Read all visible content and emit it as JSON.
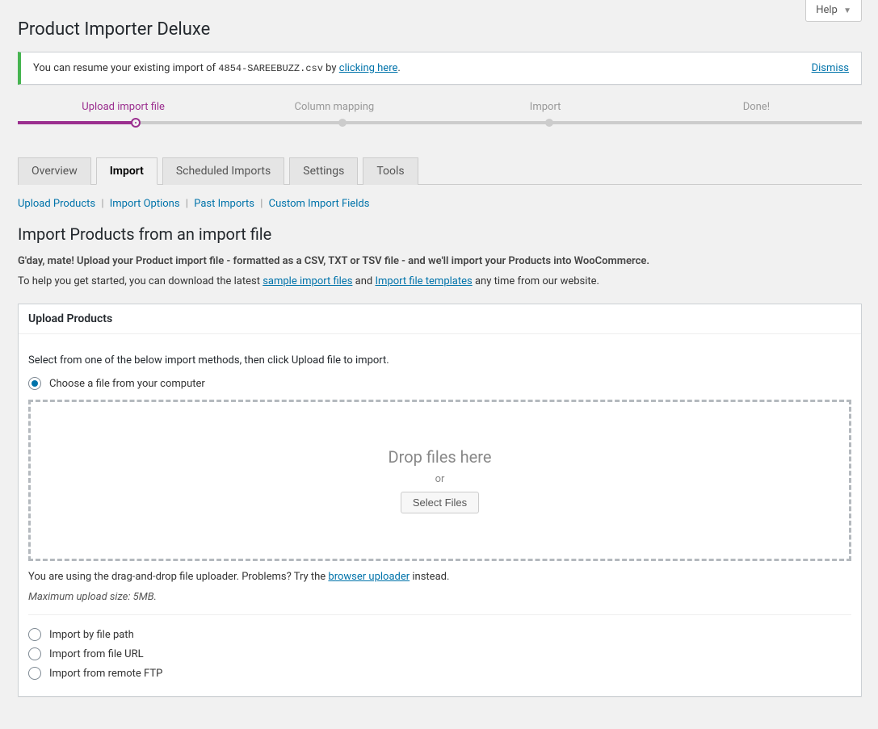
{
  "help_button": "Help",
  "page_title": "Product Importer Deluxe",
  "notice": {
    "prefix": "You can resume your existing import of ",
    "filename": "4854-SAREEBUZZ.csv",
    "by": " by ",
    "link": "clicking here",
    "suffix": ".",
    "dismiss": "Dismiss"
  },
  "steps": [
    "Upload import file",
    "Column mapping",
    "Import",
    "Done!"
  ],
  "tabs": [
    "Overview",
    "Import",
    "Scheduled Imports",
    "Settings",
    "Tools"
  ],
  "active_tab": "Import",
  "sublinks": [
    "Upload Products",
    "Import Options",
    "Past Imports",
    "Custom Import Fields"
  ],
  "section_heading": "Import Products from an import file",
  "intro_bold": "G'day, mate! Upload your Product import file - formatted as a CSV, TXT or TSV file - and we'll import your Products into WooCommerce.",
  "help_text": {
    "prefix": "To help you get started, you can download the latest ",
    "link1": "sample import files",
    "and": " and ",
    "link2": "Import file templates",
    "suffix": " any time from our website."
  },
  "postbox": {
    "title": "Upload Products",
    "select_from": "Select from one of the below import methods, then click Upload file to import.",
    "radios": [
      "Choose a file from your computer",
      "Import by file path",
      "Import from file URL",
      "Import from remote FTP"
    ],
    "dropzone": {
      "title": "Drop files here",
      "or": "or",
      "button": "Select Files"
    },
    "uploader_note": {
      "prefix": "You are using the drag-and-drop file uploader. Problems? Try the ",
      "link": "browser uploader",
      "suffix": " instead."
    },
    "max_size": "Maximum upload size: 5MB."
  }
}
